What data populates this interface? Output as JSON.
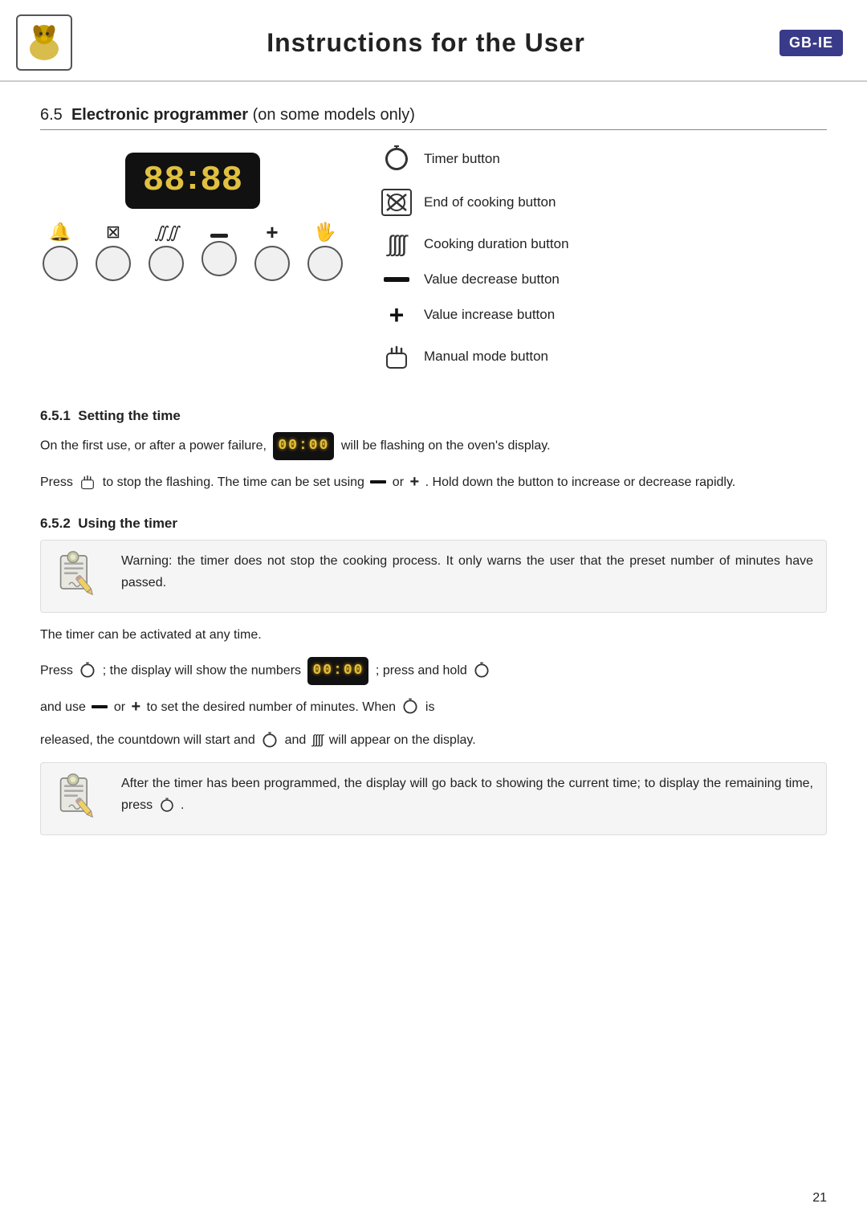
{
  "header": {
    "title": "Instructions for the User",
    "badge": "GB-IE"
  },
  "section": {
    "number": "6.5",
    "title": "Electronic programmer",
    "subtitle": "(on some models only)"
  },
  "legend": {
    "items": [
      {
        "icon": "bell",
        "label": "Timer button"
      },
      {
        "icon": "end-cooking",
        "label": "End of cooking button"
      },
      {
        "icon": "cooking-duration",
        "label": "Cooking duration button"
      },
      {
        "icon": "minus",
        "label": "Value decrease button"
      },
      {
        "icon": "plus",
        "label": "Value increase button"
      },
      {
        "icon": "manual",
        "label": "Manual mode button"
      }
    ]
  },
  "subsections": [
    {
      "number": "6.5.1",
      "title": "Setting the time",
      "paragraphs": [
        "On the first use, or after a power failure,  will be flashing on the oven's display.",
        "Press  to stop the flashing. The time can be set using  or . Hold down the button to increase or decrease rapidly."
      ]
    },
    {
      "number": "6.5.2",
      "title": "Using the timer",
      "warning": "Warning: the timer does not stop the cooking process. It only warns the user that the preset number of minutes have passed.",
      "paragraphs": [
        "The timer can be activated at any time.",
        "; the display will show the numbers  ; press and hold",
        "and use  or  to set the desired number of minutes. When  is released, the countdown will start and  and  will appear on the display.",
        "After the timer has been programmed, the display will go back to showing the current time; to display the remaining time, press  ."
      ]
    }
  ],
  "page_number": "21"
}
